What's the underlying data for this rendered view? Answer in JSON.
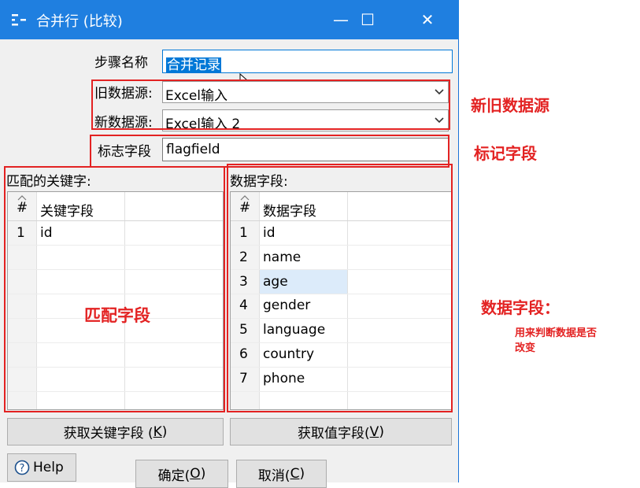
{
  "window": {
    "title": "合并行 (比较)",
    "icon": "merge-rows-icon",
    "minimize_glyph": "—",
    "maximize_glyph": "☐",
    "close_glyph": "✕"
  },
  "form": {
    "step_name_label": "步骤名称",
    "step_name_value": "合并记录",
    "old_source_label": "旧数据源:",
    "old_source_value": "Excel输入",
    "new_source_label": "新数据源:",
    "new_source_value": "Excel输入 2",
    "flag_label": "标志字段",
    "flag_value": "flagfield"
  },
  "key_grid": {
    "title": "匹配的关键字:",
    "header_num": "#",
    "header_col": "关键字段",
    "rows": [
      {
        "num": "1",
        "value": "id"
      }
    ]
  },
  "value_grid": {
    "title": "数据字段:",
    "header_num": "#",
    "header_col": "数据字段",
    "rows": [
      {
        "num": "1",
        "value": "id"
      },
      {
        "num": "2",
        "value": "name"
      },
      {
        "num": "3",
        "value": "age"
      },
      {
        "num": "4",
        "value": "gender"
      },
      {
        "num": "5",
        "value": "language"
      },
      {
        "num": "6",
        "value": "country"
      },
      {
        "num": "7",
        "value": "phone"
      }
    ],
    "highlighted_row": 3
  },
  "buttons": {
    "get_keys_text": "获取关键字段 (",
    "get_keys_key": "K",
    "get_keys_end": ")",
    "get_values_text": "获取值字段(",
    "get_values_key": "V",
    "get_values_end": ")",
    "help": "Help",
    "ok_text": "确定(",
    "ok_key": "O",
    "ok_end": ")",
    "cancel_text": "取消(",
    "cancel_key": "C",
    "cancel_end": ")"
  },
  "annotations": {
    "source": "新旧数据源",
    "flag": "标记字段",
    "match": "匹配字段",
    "data_title": "数据字段：",
    "data_desc_line1": "用来判断数据是否",
    "data_desc_line2": "改变"
  },
  "colors": {
    "titlebar": "#1f7fe0",
    "annotation_red": "#e32222",
    "selection": "#0078d7",
    "row_highlight": "#dcebfa"
  }
}
